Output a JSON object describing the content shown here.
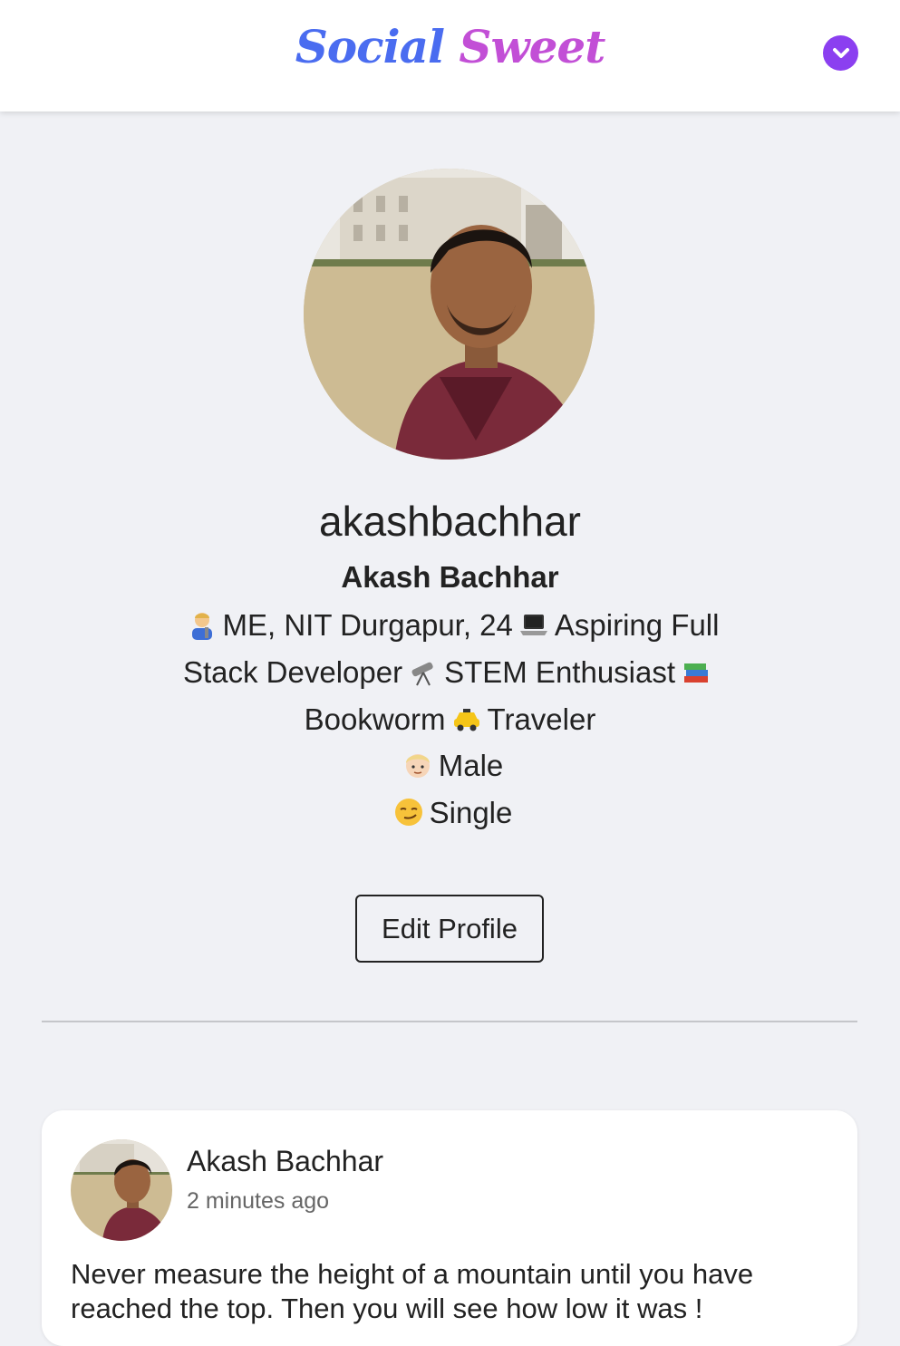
{
  "header": {
    "logo_word1": "Social",
    "logo_word2": "Sweet",
    "menu_icon": "chevron-down-icon",
    "accent_color": "#8b3ff0"
  },
  "profile": {
    "photo": "profile-photo",
    "username": "akashbachhar",
    "full_name": "Akash Bachhar",
    "bio": {
      "part1": "ME, NIT Durgapur, 24",
      "part2": "Aspiring Full Stack Developer",
      "part3": "STEM Enthusiast",
      "part4": "Bookworm",
      "part5": "Traveler"
    },
    "gender": "Male",
    "relationship": "Single",
    "edit_button": "Edit Profile"
  },
  "posts": [
    {
      "author": "Akash Bachhar",
      "time": "2 minutes ago",
      "text": "Never measure the height of a mountain until you have reached the top. Then you will see how low it was !"
    }
  ]
}
